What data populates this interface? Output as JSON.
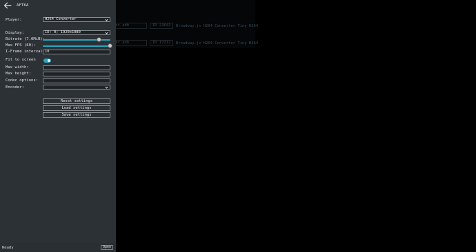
{
  "header": {
    "title": "AFTKA"
  },
  "settings": {
    "player": {
      "label": "Player:",
      "value": "H264 Converter"
    },
    "display": {
      "label": "Display:",
      "value": "ID: 0; 1920x1080"
    },
    "bitrate": {
      "label": "Bitrate (7.0MiB):",
      "level": 0.84
    },
    "max_fps": {
      "label": "Max FPS (60):",
      "level": 1.0
    },
    "iframe_interval": {
      "label": "I-Frame interval:",
      "value": "10"
    },
    "fit_to_screen": {
      "label": "Fit to screen",
      "on": true
    },
    "max_width": {
      "label": "Max width:",
      "value": ""
    },
    "max_height": {
      "label": "Max height:",
      "value": ""
    },
    "codec_options": {
      "label": "Codec options:",
      "value": ""
    },
    "encoder": {
      "label": "Encoder:",
      "value": ""
    }
  },
  "buttons": {
    "reset": "Reset settings",
    "load": "Load settings",
    "save": "Save settings"
  },
  "statusbar": {
    "status": "Ready",
    "open_label": "Open"
  },
  "background_rows": [
    {
      "name": "ver adb",
      "port": "ID  21641",
      "desc": "Broadway.js H264 Converter Tiny H264"
    },
    {
      "name": "ver adb",
      "port": "ID  17212",
      "desc": "Broadway.js H264 Converter Tiny H264"
    }
  ]
}
